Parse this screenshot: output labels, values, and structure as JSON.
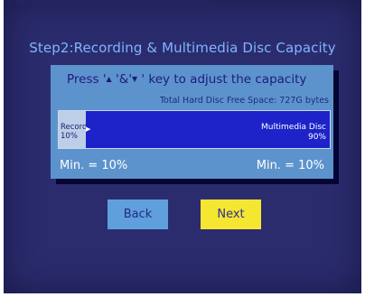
{
  "dialog": {
    "step_title": "Step2:Recording & Multimedia Disc Capacity",
    "instruction": {
      "before": "Press '",
      "up_symbol": "▲",
      "middle": " '&'",
      "down_symbol": "▼",
      "after": " ' key to adjust the capacity"
    },
    "free_space": "Total Hard Disc Free Space: 727G  bytes",
    "capacity_bar": {
      "recording_label": "Recording",
      "recording_percent": "10%",
      "recording_fraction": 0.1,
      "multimedia_label": "Multimedia Disc",
      "multimedia_percent": "90%"
    },
    "min_left": "Min. = 10%",
    "min_right": "Min. = 10%"
  },
  "buttons": {
    "back_label": "Back",
    "next_label": "Next"
  },
  "colors": {
    "background": "#2b2c6e",
    "panel": "#5d93cc",
    "bar_fill": "#1d23c9",
    "selected_button": "#f5e632"
  }
}
